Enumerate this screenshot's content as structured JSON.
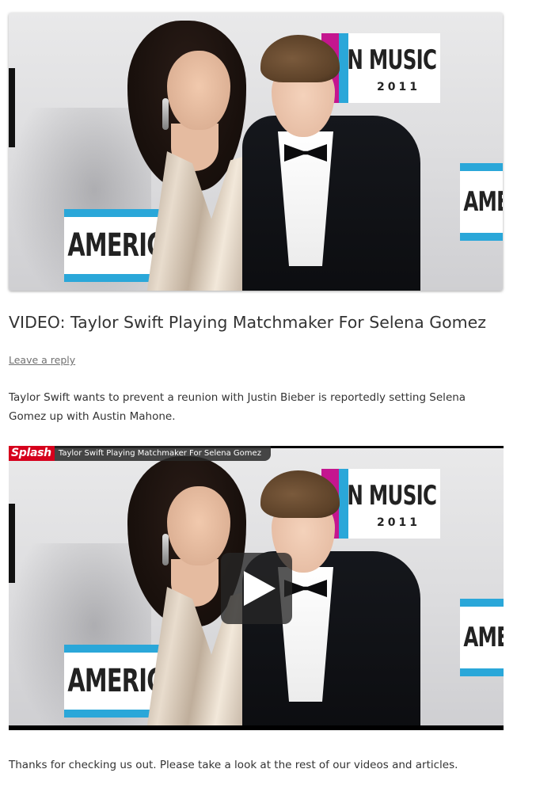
{
  "featured_image": {
    "alt": "",
    "banner_top_text": "N MUSIC AWARDS",
    "banner_top_year": "2011",
    "banner_left_text": "AMERICAN MU",
    "banner_right_text": "AMERIC",
    "colors": {
      "magenta": "#c4168f",
      "blue": "#2aa7d9"
    }
  },
  "post": {
    "title": "VIDEO: Taylor Swift Playing Matchmaker For Selena Gomez",
    "reply_link": "Leave a reply",
    "intro_text": "Taylor Swift wants to prevent a reunion with Justin Bieber is reportedly setting Selena Gomez up with Austin Mahone.",
    "outro_text": "Thanks for checking us out. Please take a look at the rest of our videos and articles."
  },
  "video": {
    "brand_logo": "Splash",
    "title": "Taylor Swift Playing Matchmaker For Selena Gomez",
    "play_icon": "play-icon",
    "banner_top_text": "N MUSIC AWARDS",
    "banner_top_year": "2011",
    "banner_left_text": "AMERICAN MU",
    "banner_right_text": "AMERIC",
    "colors": {
      "brand_red": "#d6001c",
      "title_bar": "#282828"
    }
  }
}
